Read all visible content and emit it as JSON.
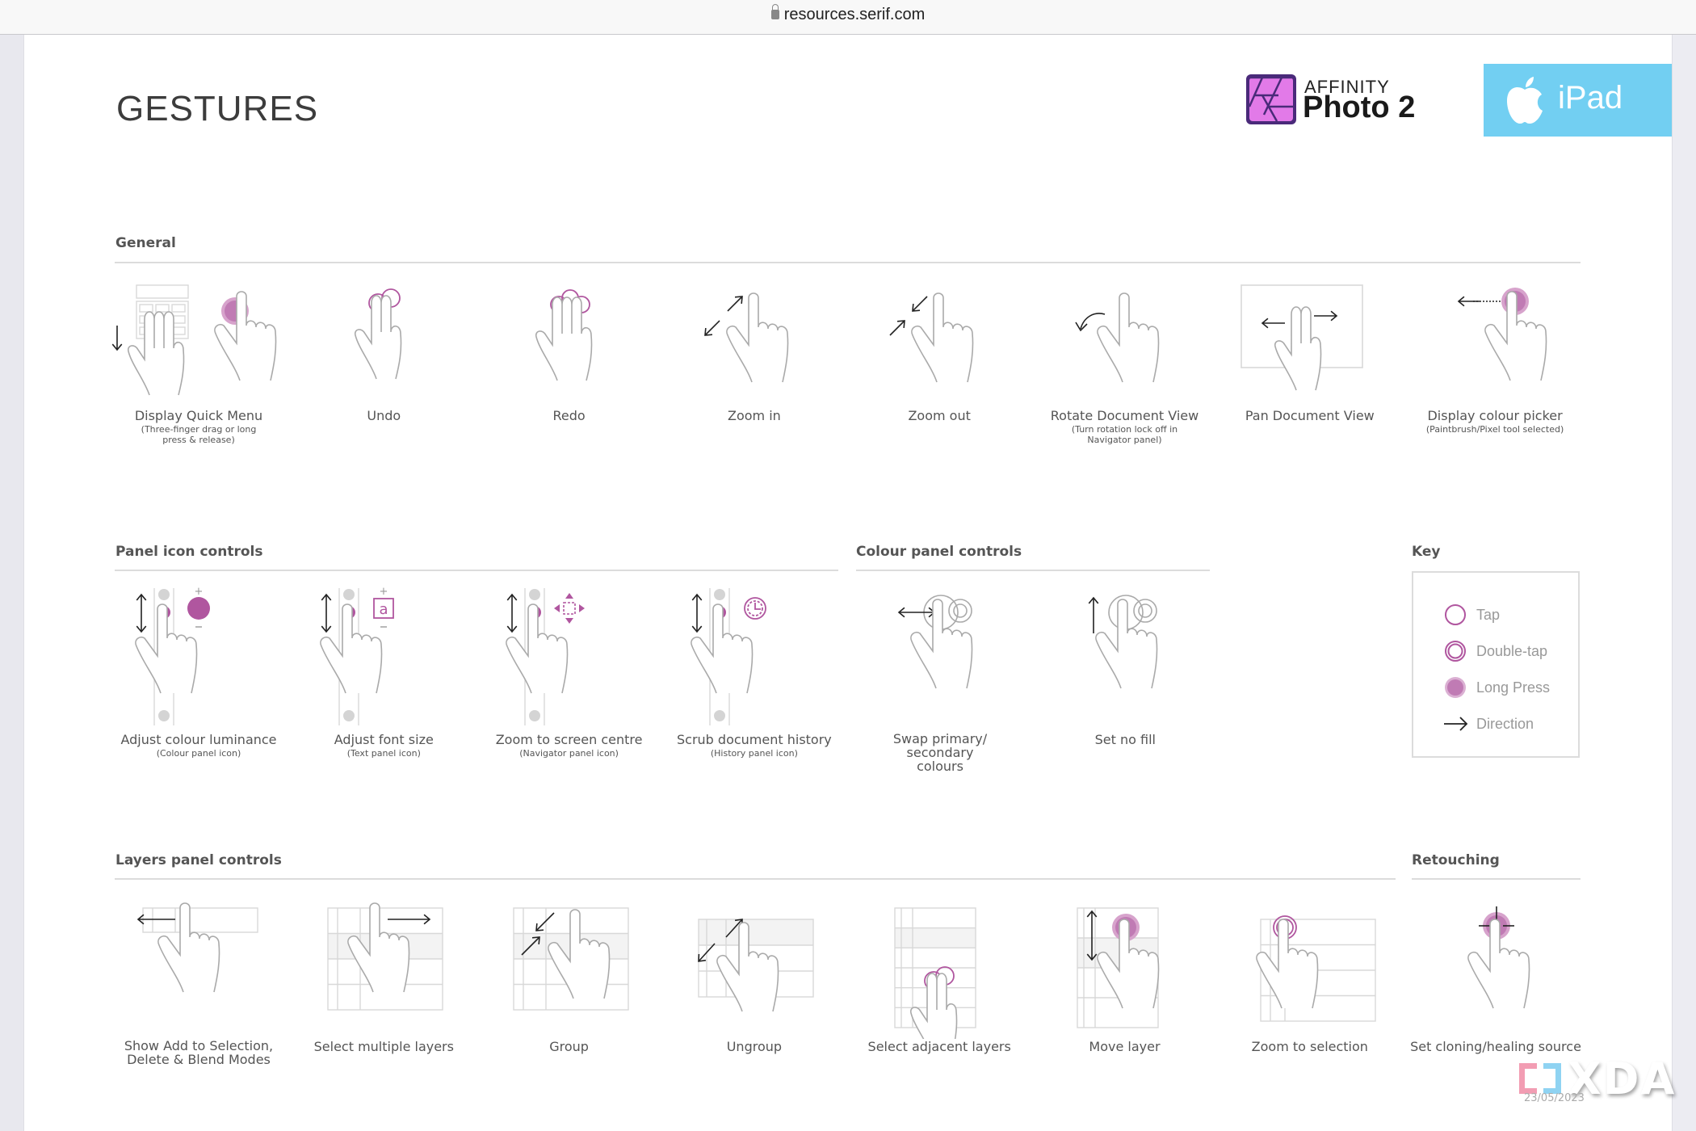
{
  "browser": {
    "url": "resources.serif.com"
  },
  "page": {
    "title": "GESTURES"
  },
  "brand": {
    "small": "AFFINITY",
    "big": "Photo 2",
    "platform": "iPad"
  },
  "colors": {
    "accent": "#b0569f",
    "accent_light": "#d7a3cc",
    "line": "#aaaaaa",
    "grid": "#d8d8d8",
    "arrow": "#222222",
    "ipad": "#72cff2"
  },
  "sections": {
    "general": {
      "title": "General",
      "items": [
        {
          "label": "Display Quick Menu",
          "sub": "(Three-finger drag or long press & release)",
          "gesture": "quick-menu"
        },
        {
          "label": "Undo",
          "sub": "",
          "gesture": "two-finger-tap"
        },
        {
          "label": "Redo",
          "sub": "",
          "gesture": "three-finger-tap"
        },
        {
          "label": "Zoom in",
          "sub": "",
          "gesture": "zoom-in"
        },
        {
          "label": "Zoom out",
          "sub": "",
          "gesture": "zoom-out"
        },
        {
          "label": "Rotate Document View",
          "sub": "(Turn rotation lock off in Navigator panel)",
          "gesture": "rotate"
        },
        {
          "label": "Pan Document View",
          "sub": "",
          "gesture": "pan"
        },
        {
          "label": "Display colour picker",
          "sub": "(Paintbrush/Pixel tool selected)",
          "gesture": "colour-picker"
        }
      ]
    },
    "panel_icon": {
      "title": "Panel icon controls",
      "items": [
        {
          "label": "Adjust colour luminance",
          "sub": "(Colour panel icon)",
          "gesture": "panel-colour"
        },
        {
          "label": "Adjust font size",
          "sub": "(Text panel icon)",
          "gesture": "panel-text"
        },
        {
          "label": "Zoom to screen centre",
          "sub": "(Navigator panel icon)",
          "gesture": "panel-navigator"
        },
        {
          "label": "Scrub document history",
          "sub": "(History panel icon)",
          "gesture": "panel-history"
        }
      ]
    },
    "colour_panel": {
      "title": "Colour panel controls",
      "items": [
        {
          "label": "Swap primary/ secondary colours",
          "sub": "",
          "gesture": "swap-colours"
        },
        {
          "label": "Set no fill",
          "sub": "",
          "gesture": "no-fill"
        }
      ]
    },
    "key": {
      "title": "Key",
      "items": [
        {
          "label": "Tap",
          "icon": "tap"
        },
        {
          "label": "Double-tap",
          "icon": "double-tap"
        },
        {
          "label": "Long Press",
          "icon": "long-press"
        },
        {
          "label": "Direction",
          "icon": "direction"
        }
      ]
    },
    "layers": {
      "title": "Layers panel controls",
      "items": [
        {
          "label": "Show Add to Selection, Delete & Blend Modes",
          "sub": "",
          "gesture": "layer-swipe-left"
        },
        {
          "label": "Select multiple layers",
          "sub": "",
          "gesture": "layer-swipe-right"
        },
        {
          "label": "Group",
          "sub": "",
          "gesture": "layer-group"
        },
        {
          "label": "Ungroup",
          "sub": "",
          "gesture": "layer-ungroup"
        },
        {
          "label": "Select adjacent layers",
          "sub": "",
          "gesture": "layer-adjacent"
        },
        {
          "label": "Move layer",
          "sub": "",
          "gesture": "layer-move"
        },
        {
          "label": "Zoom to selection",
          "sub": "",
          "gesture": "layer-zoom"
        }
      ]
    },
    "retouching": {
      "title": "Retouching",
      "items": [
        {
          "label": "Set cloning/healing source",
          "sub": "",
          "gesture": "clone-source"
        }
      ]
    }
  },
  "watermark": {
    "brand": "XDA",
    "date": "23/05/2023"
  }
}
